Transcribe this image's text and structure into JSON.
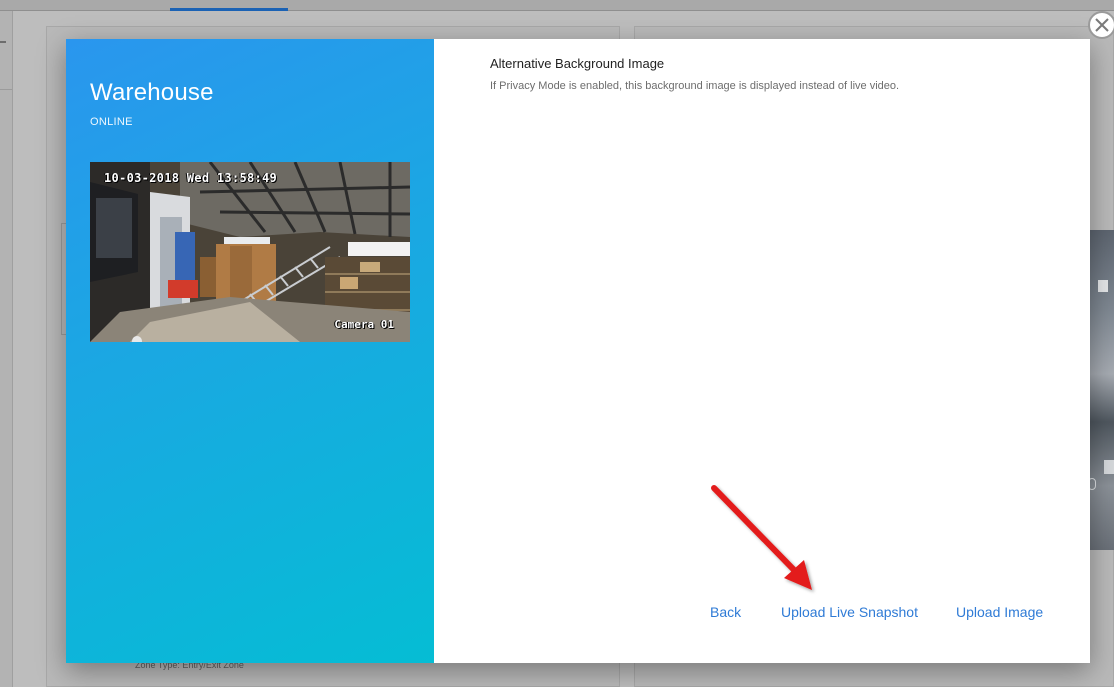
{
  "background": {
    "zone_type_text": "Zone Type: Entry/Exit Zone"
  },
  "device": {
    "name": "Warehouse",
    "status": "ONLINE",
    "camera_overlay_timestamp": "10-03-2018 Wed 13:58:49",
    "camera_overlay_label": "Camera 01"
  },
  "section": {
    "title": "Alternative Background Image",
    "description": "If Privacy Mode is enabled, this background image is displayed instead of live video."
  },
  "actions": {
    "back": "Back",
    "upload_live_snapshot": "Upload Live Snapshot",
    "upload_image": "Upload Image"
  },
  "colors": {
    "gradient_start": "#2a96ee",
    "gradient_end": "#05bdd4",
    "link": "#2f7bd6",
    "annotation_arrow": "#e31b1b"
  },
  "icons": {
    "close": "close-icon",
    "arrow": "annotation-arrow"
  }
}
